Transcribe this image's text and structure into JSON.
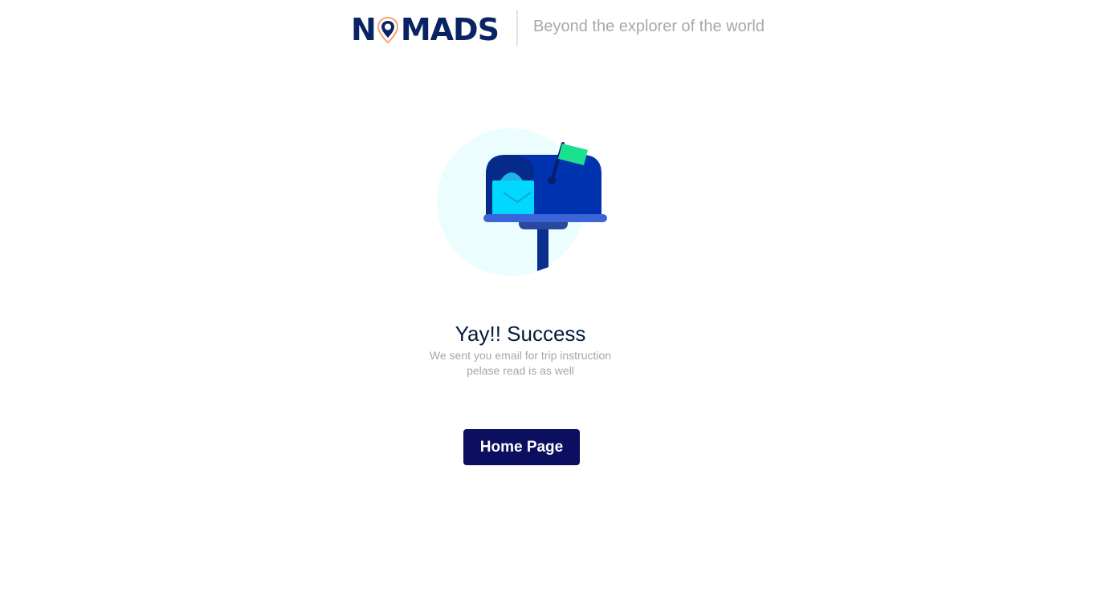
{
  "header": {
    "logo": {
      "prefix": "N",
      "suffix": "MADS",
      "icon": "map-pin-icon"
    },
    "tagline": "Beyond the explorer of the world"
  },
  "success": {
    "illustration": "mailbox-icon",
    "title": "Yay!! Success",
    "message_line1": "We sent you email for trip instruction",
    "message_line2": "pelase read is as well"
  },
  "actions": {
    "home_label": "Home Page"
  },
  "colors": {
    "brand_navy": "#0a2463",
    "button_bg": "#0c0f5f",
    "mailbox_blue": "#0033b0",
    "envelope_cyan": "#00d8ff",
    "flag_green": "#1be08f",
    "circle_bg": "#ebfdff"
  }
}
